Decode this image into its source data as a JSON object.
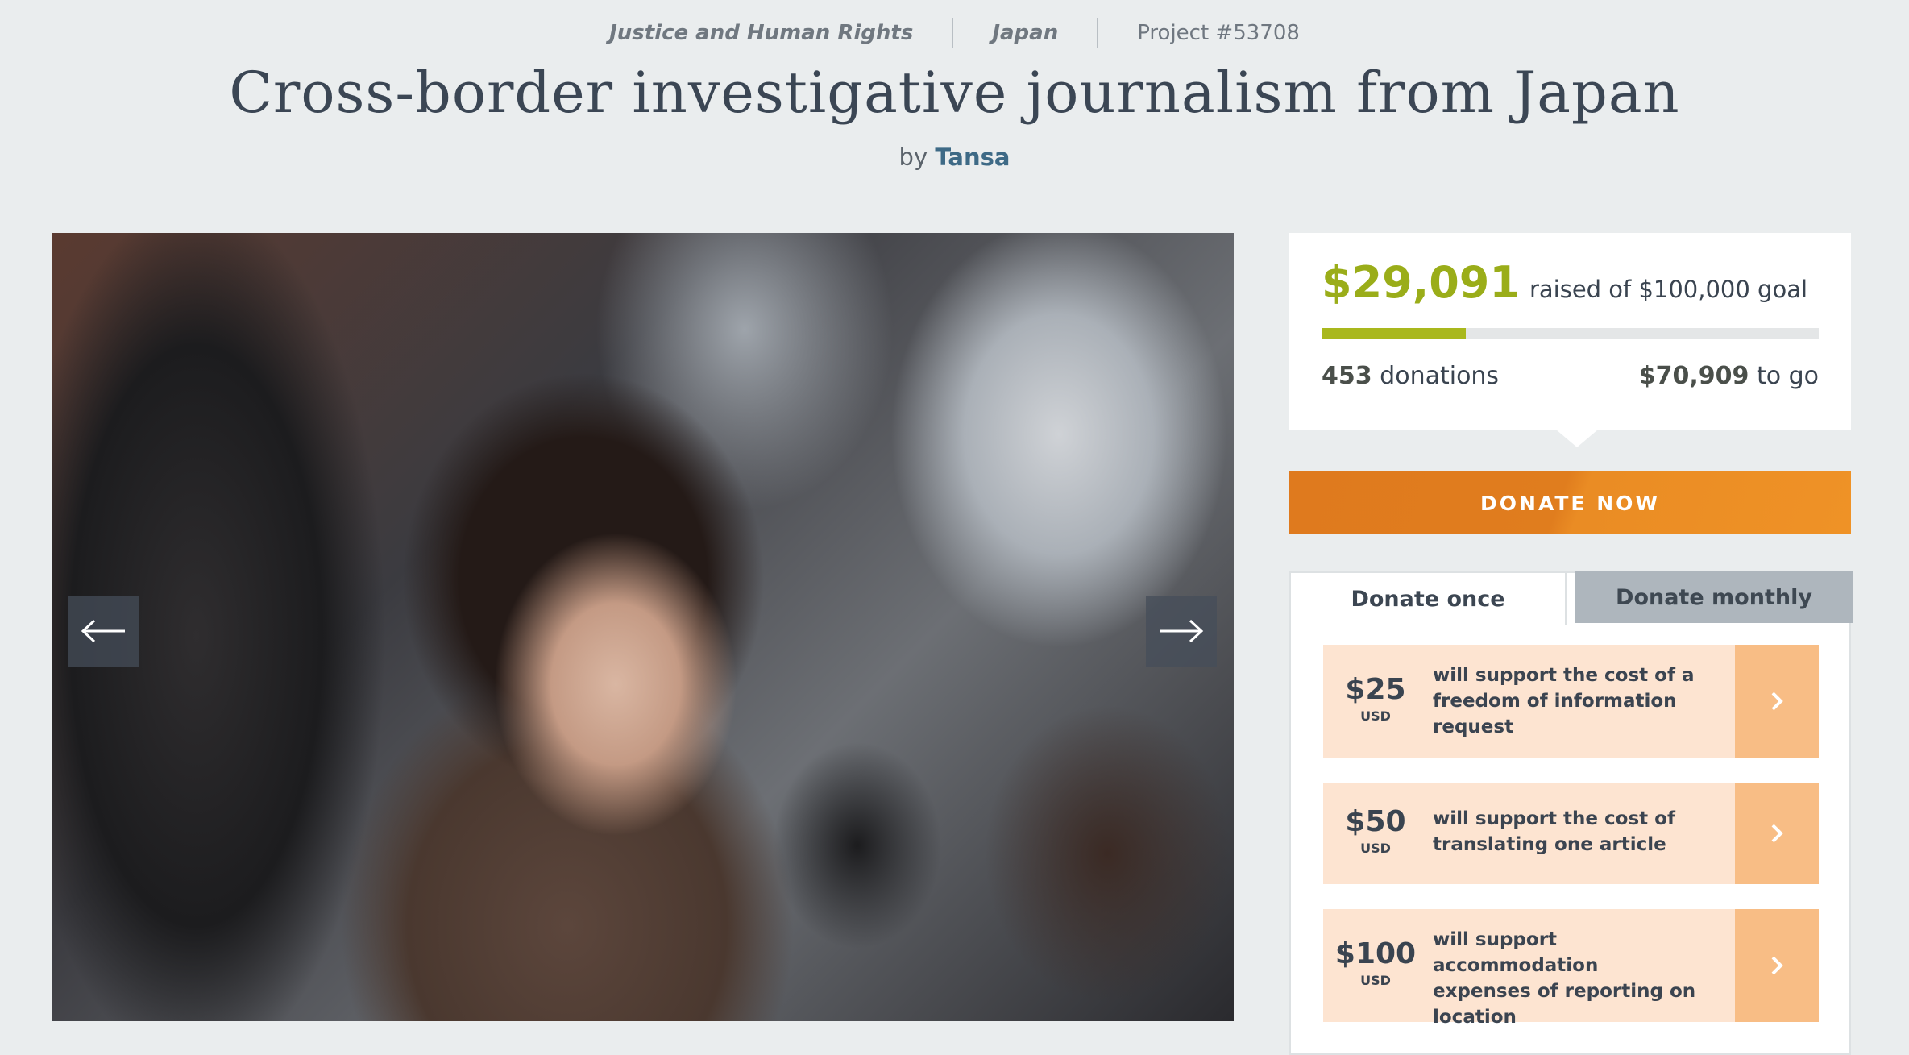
{
  "breadcrumbs": {
    "category": "Justice and Human Rights",
    "country": "Japan",
    "project_id": "Project #53708"
  },
  "title": "Cross-border investigative journalism from Japan",
  "byline": {
    "prefix": "by",
    "organization": "Tansa"
  },
  "photo": {
    "prev_icon": "arrow-left-icon",
    "next_icon": "arrow-right-icon"
  },
  "funding": {
    "raised_amount": "$29,091",
    "raised_text": "raised of $100,000 goal",
    "progress_fraction": 0.29091,
    "donations_count": "453",
    "donations_label": "donations",
    "to_go_amount": "$70,909",
    "to_go_label": "to go",
    "accent_color": "#9aad19"
  },
  "donate_button": {
    "label": "DONATE NOW",
    "color": "#e07d1e"
  },
  "tabs": [
    {
      "label": "Donate once",
      "active": true
    },
    {
      "label": "Donate monthly",
      "active": false
    }
  ],
  "options": [
    {
      "amount": "$25",
      "currency": "USD",
      "description": "will support the cost of a freedom of information request"
    },
    {
      "amount": "$50",
      "currency": "USD",
      "description": "will support the cost of translating one article"
    },
    {
      "amount": "$100",
      "currency": "USD",
      "description": "will support accommodation expenses of reporting on location"
    }
  ],
  "option_arrow_icon": "chevron-right-icon"
}
